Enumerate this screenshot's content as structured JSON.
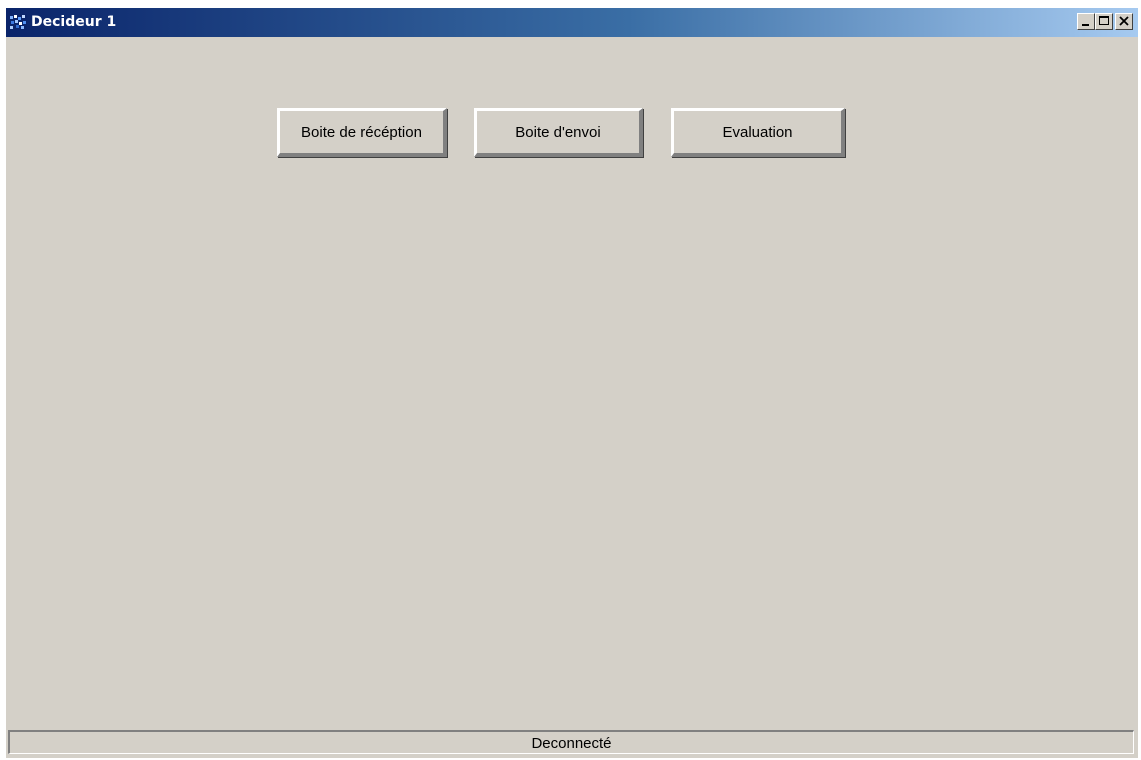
{
  "window": {
    "title": "Decideur 1",
    "icon": "app-grid-icon",
    "controls": [
      "minimize-icon",
      "maximize-icon",
      "close-icon"
    ]
  },
  "toolbar": {
    "inbox_label": "Boite de récéption",
    "outbox_label": "Boite d'envoi",
    "evaluation_label": "Evaluation"
  },
  "status": {
    "text": "Deconnecté"
  },
  "colors": {
    "titlebar_start": "#0a246a",
    "titlebar_end": "#a6caf0",
    "window_bg": "#d4d0c8"
  }
}
